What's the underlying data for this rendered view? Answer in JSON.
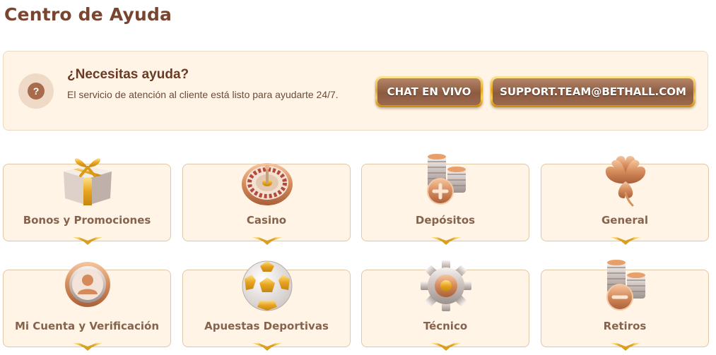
{
  "page": {
    "title": "Centro de Ayuda"
  },
  "help": {
    "icon_symbol": "?",
    "icon_name": "question-icon",
    "heading": "¿Necesitas ayuda?",
    "description": "El servicio de atención al cliente está listo para ayudarte 24/7.",
    "chat_button": "CHAT EN VIVO",
    "email_button": "SUPPORT.TEAM@BETHALL.COM"
  },
  "categories": [
    {
      "label": "Bonos y Promociones",
      "icon": "gift-icon"
    },
    {
      "label": "Casino",
      "icon": "roulette-icon"
    },
    {
      "label": "Depósitos",
      "icon": "coins-plus-icon"
    },
    {
      "label": "General",
      "icon": "clover-icon"
    },
    {
      "label": "Mi Cuenta y Verificación",
      "icon": "user-icon"
    },
    {
      "label": "Apuestas Deportivas",
      "icon": "soccer-ball-icon"
    },
    {
      "label": "Técnico",
      "icon": "gear-icon"
    },
    {
      "label": "Retiros",
      "icon": "coins-minus-icon"
    }
  ],
  "colors": {
    "title": "#7a4530",
    "card_background": "#fff4e6",
    "card_border": "#e2c7a6",
    "gold": "#e7a51f",
    "button_brown": "#8b5a40"
  }
}
